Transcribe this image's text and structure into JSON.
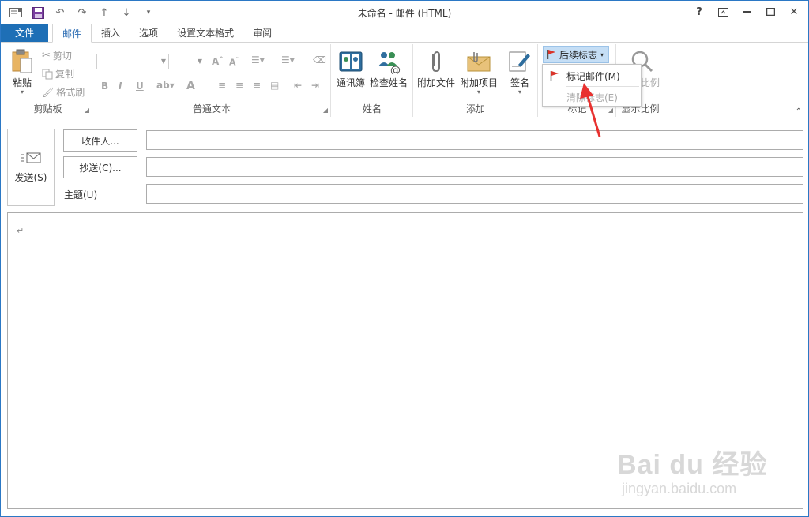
{
  "window": {
    "title": "未命名 - 邮件 (HTML)",
    "controls": [
      "?",
      "restore",
      "minimize",
      "maximize",
      "close"
    ]
  },
  "qat": {
    "icons": [
      "mail-icon",
      "save-icon",
      "undo-icon",
      "redo-icon",
      "up-icon",
      "down-icon",
      "customize-icon"
    ]
  },
  "tabs": [
    {
      "label": "文件",
      "type": "file"
    },
    {
      "label": "邮件",
      "active": true
    },
    {
      "label": "插入"
    },
    {
      "label": "选项"
    },
    {
      "label": "设置文本格式"
    },
    {
      "label": "审阅"
    }
  ],
  "ribbon": {
    "clipboard": {
      "label": "剪贴板",
      "paste": "粘贴",
      "cut": "剪切",
      "copy": "复制",
      "format_painter": "格式刷"
    },
    "basic_text": {
      "label": "普通文本",
      "bold": "B",
      "italic": "I",
      "underline": "U",
      "font_color": "A"
    },
    "names": {
      "label": "姓名",
      "address_book": "通讯簿",
      "check_names": "检查姓名"
    },
    "include": {
      "label": "添加",
      "attach_file": "附加文件",
      "attach_item": "附加项目",
      "signature": "签名"
    },
    "tags": {
      "label": "标记",
      "follow_up": "后续标志",
      "menu": [
        {
          "label": "标记邮件(M)",
          "enabled": true
        },
        {
          "label": "清除标志(E)",
          "enabled": false
        }
      ]
    },
    "zoom": {
      "label": "显示比例",
      "zoom_btn": "比例"
    }
  },
  "compose": {
    "send": "发送(S)",
    "to": "收件人...",
    "cc": "抄送(C)...",
    "subject": "主题(U)",
    "to_value": "",
    "cc_value": "",
    "subject_value": "",
    "body_mark": "↵"
  },
  "watermark": {
    "main": "Bai du 经验",
    "sub": "jingyan.baidu.com"
  },
  "colors": {
    "accent": "#1e6fb6",
    "tab_active_text": "#2b6cb3",
    "followup_bg": "#c5def5",
    "flag_red": "#d9342b",
    "annotation_arrow": "#e8312f"
  }
}
